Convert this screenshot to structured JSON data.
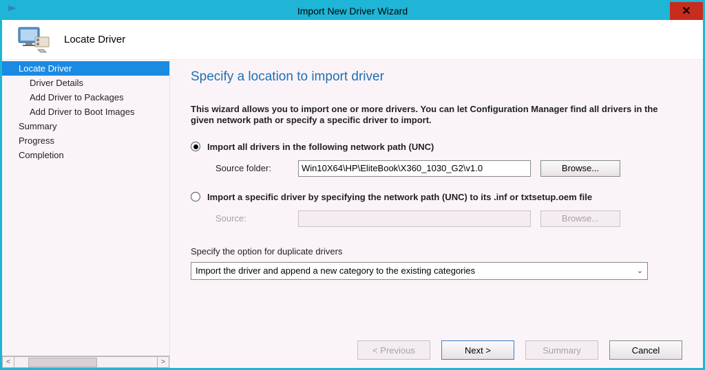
{
  "window": {
    "title": "Import New Driver Wizard",
    "header_title": "Locate Driver"
  },
  "sidebar": {
    "items": [
      {
        "label": "Locate Driver",
        "selected": true,
        "sub": false
      },
      {
        "label": "Driver Details",
        "selected": false,
        "sub": true
      },
      {
        "label": "Add Driver to Packages",
        "selected": false,
        "sub": true
      },
      {
        "label": "Add Driver to Boot Images",
        "selected": false,
        "sub": true
      },
      {
        "label": "Summary",
        "selected": false,
        "sub": false
      },
      {
        "label": "Progress",
        "selected": false,
        "sub": false
      },
      {
        "label": "Completion",
        "selected": false,
        "sub": false
      }
    ]
  },
  "main": {
    "heading": "Specify a location to import driver",
    "intro": "This wizard allows you to import one or more drivers. You can let Configuration Manager find all drivers in the given network path or specify a specific driver to import.",
    "option1": {
      "label": "Import all drivers in the following network path (UNC)",
      "field_label": "Source folder:",
      "field_value": "Win10X64\\HP\\EliteBook\\X360_1030_G2\\v1.0",
      "browse_label": "Browse..."
    },
    "option2": {
      "label": "Import a specific driver by specifying the network path (UNC) to its .inf or txtsetup.oem file",
      "field_label": "Source:",
      "field_value": "",
      "browse_label": "Browse..."
    },
    "duplicate": {
      "label": "Specify the option for duplicate drivers",
      "selected": "Import the driver and append a new category to the existing categories"
    }
  },
  "footer": {
    "previous": "< Previous",
    "next": "Next >",
    "summary": "Summary",
    "cancel": "Cancel"
  }
}
